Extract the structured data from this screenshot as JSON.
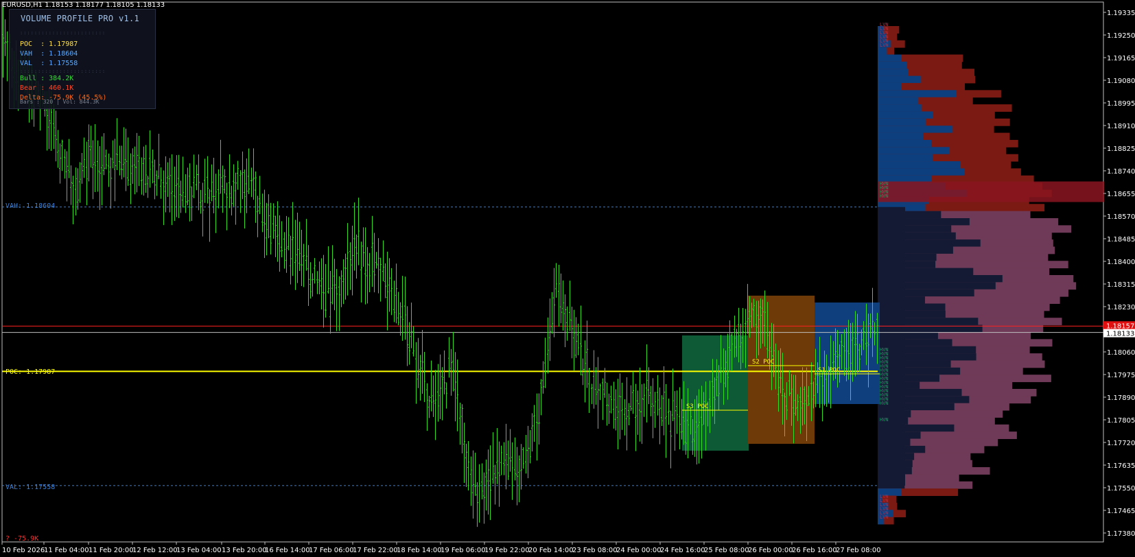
{
  "window": {
    "symbol_line": "EURUSD,H1  1.18153 1.18177 1.18105 1.18133"
  },
  "panel": {
    "title": "VOLUME PROFILE PRO v1.1",
    "poc": "POC  : 1.17987",
    "vah": "VAH  : 1.18604",
    "val": "VAL  : 1.17558",
    "bull": "Bull : 384.2K",
    "bear": "Bear : 460.1K",
    "delta": "Delta: -75.9K (45.5%)",
    "footer": "Bars : 320 | Vol: 844.3K",
    "separator": "::::::::::::::::::::::::"
  },
  "levels": {
    "vah_label": "VAH: 1.18604",
    "poc_label": "POC: 1.17987",
    "val_label": "VAL: 1.17558",
    "delta_bottom": "? -75.9K"
  },
  "sessions": {
    "s1_label": "S1 POC",
    "s2_label": "S2 POC",
    "s3_label": "S3 POC"
  },
  "profile_tags": {
    "hvn": "HVN",
    "lvn": "LVN"
  },
  "price_axis": {
    "ticks": [
      "1.19335",
      "1.19250",
      "1.19165",
      "1.19080",
      "1.18995",
      "1.18910",
      "1.18825",
      "1.18740",
      "1.18655",
      "1.18570",
      "1.18485",
      "1.18400",
      "1.18315",
      "1.18230",
      "1.18145",
      "1.18060",
      "1.17975",
      "1.17890",
      "1.17805",
      "1.17720",
      "1.17635",
      "1.17550",
      "1.17465",
      "1.17380"
    ],
    "bid_tag": "1.18157",
    "last_tag": "1.18133"
  },
  "time_axis": {
    "ticks": [
      "10 Feb 2026",
      "11 Feb 04:00",
      "11 Feb 20:00",
      "12 Feb 12:00",
      "13 Feb 04:00",
      "13 Feb 20:00",
      "16 Feb 14:00",
      "17 Feb 06:00",
      "17 Feb 22:00",
      "18 Feb 14:00",
      "19 Feb 06:00",
      "19 Feb 22:00",
      "20 Feb 14:00",
      "23 Feb 08:00",
      "24 Feb 00:00",
      "24 Feb 16:00",
      "25 Feb 08:00",
      "26 Feb 00:00",
      "26 Feb 16:00",
      "27 Feb 08:00"
    ]
  },
  "colors": {
    "background": "#000000",
    "candle": "#33dd22",
    "vah_val": "#3a7fd8",
    "poc": "#ffff00",
    "bid_line": "#ff2020",
    "last_line": "#c0c0c0",
    "profile_bear": "#7a1a12",
    "profile_bull": "#0d3f7e",
    "profile_outer": "#6e3a57",
    "session_green": "#0f5a36",
    "session_orange": "#6e3a07",
    "session_blue": "#0f3f7c",
    "hvn_text": "#00aa55",
    "lvn_text": "#cc2244"
  }
}
